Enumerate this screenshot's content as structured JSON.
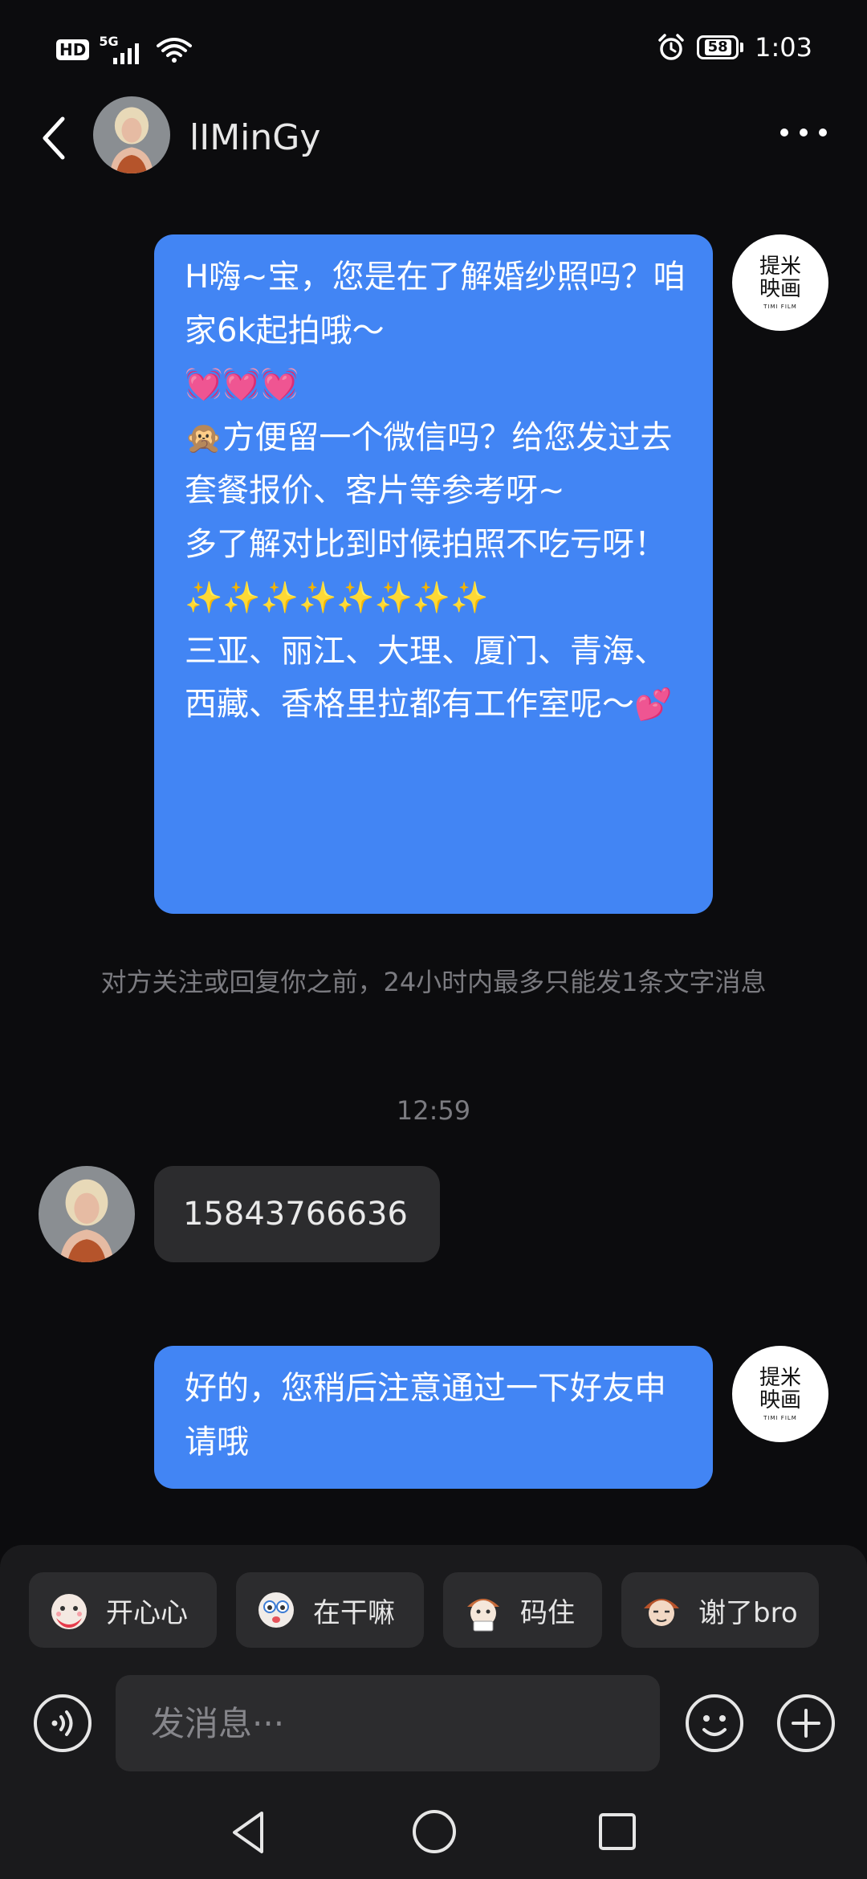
{
  "status_bar": {
    "hd": "HD",
    "network": "5G",
    "battery": "58",
    "time": "1:03"
  },
  "header": {
    "contact_name": "lIMinGy",
    "back_icon": "chevron-left-icon",
    "more_icon": "more-dots-icon"
  },
  "brand_avatar": {
    "line1": "提米",
    "line2": "映画",
    "small": "TIMI FILM"
  },
  "messages": {
    "m1": {
      "l1": "H嗨~宝，您是在了解婚纱照吗？咱家6k起拍哦～",
      "hearts": "💓💓💓",
      "l2_emoji": "🙊",
      "l2": "方便留一个微信吗？给您发过去套餐报价、客片等参考呀~",
      "l3": "多了解对比到时候拍照不吃亏呀！",
      "sparkles": "✨✨✨✨✨✨✨✨",
      "l4": "三亚、丽江、大理、厦门、青海、西藏、香格里拉都有工作室呢～",
      "l4_emoji": "💕"
    },
    "system_note": "对方关注或回复你之前，24小时内最多只能发1条文字消息",
    "timestamp": "12:59",
    "m2": "15843766636",
    "m3": "好的，您稍后注意通过一下好友申请哦"
  },
  "quick_replies": [
    {
      "label": "开心心",
      "icon": "happy-sticker-icon"
    },
    {
      "label": "在干嘛",
      "icon": "curious-sticker-icon"
    },
    {
      "label": "码住",
      "icon": "note-sticker-icon"
    },
    {
      "label": "谢了bro",
      "icon": "thanks-sticker-icon"
    }
  ],
  "composer": {
    "placeholder": "发消息···"
  },
  "colors": {
    "background": "#0c0c0e",
    "outgoing_bubble": "#4285f4",
    "incoming_bubble": "#2c2c2e",
    "panel": "#1a1a1c"
  }
}
